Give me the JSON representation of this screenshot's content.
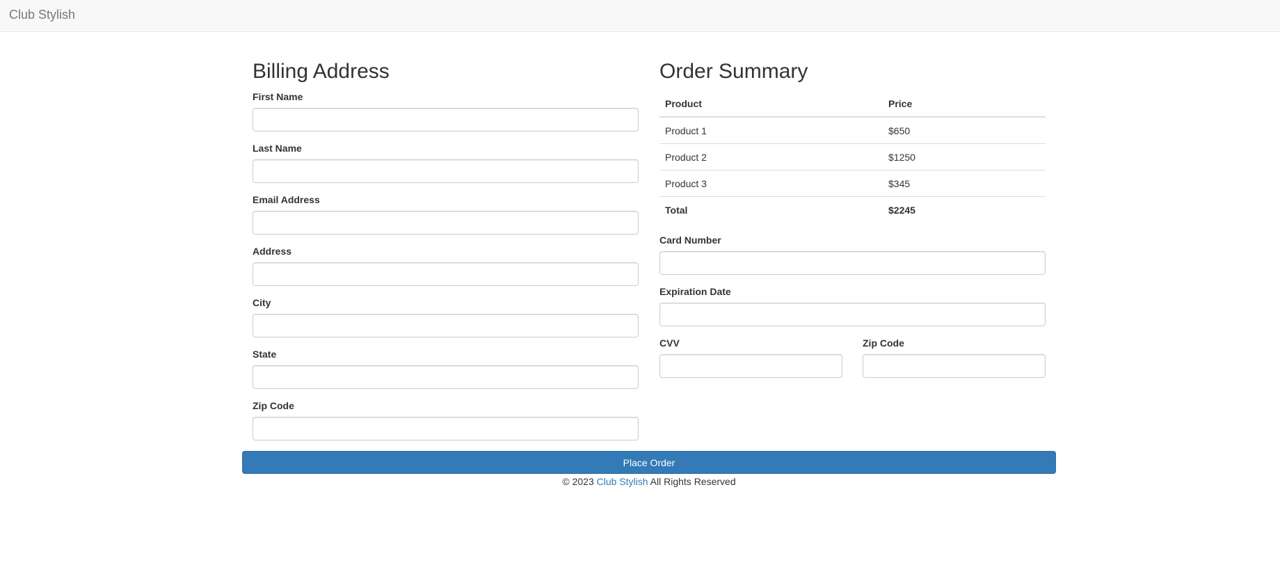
{
  "navbar": {
    "brand": "Club Stylish"
  },
  "billing": {
    "title": "Billing Address",
    "fields": [
      {
        "label": "First Name",
        "value": "",
        "placeholder": ""
      },
      {
        "label": "Last Name",
        "value": "",
        "placeholder": ""
      },
      {
        "label": "Email Address",
        "value": "",
        "placeholder": ""
      },
      {
        "label": "Address",
        "value": "",
        "placeholder": ""
      },
      {
        "label": "City",
        "value": "",
        "placeholder": ""
      },
      {
        "label": "State",
        "value": "",
        "placeholder": ""
      },
      {
        "label": "Zip Code",
        "value": "",
        "placeholder": ""
      }
    ]
  },
  "summary": {
    "title": "Order Summary",
    "columns": [
      "Product",
      "Price"
    ],
    "rows": [
      {
        "product": "Product 1",
        "price": "$650"
      },
      {
        "product": "Product 2",
        "price": "$1250"
      },
      {
        "product": "Product 3",
        "price": "$345"
      }
    ],
    "total": {
      "label": "Total",
      "price": "$2245"
    }
  },
  "payment": {
    "card_number": {
      "label": "Card Number",
      "value": ""
    },
    "expiration": {
      "label": "Expiration Date",
      "value": ""
    },
    "cvv": {
      "label": "CVV",
      "value": ""
    },
    "zip": {
      "label": "Zip Code",
      "value": ""
    }
  },
  "actions": {
    "place_order": "Place Order"
  },
  "footer": {
    "prefix": "© 2023",
    "link": "Club Stylish",
    "suffix": "All Rights Reserved"
  },
  "colors": {
    "primary": "#337ab7",
    "navbar_bg": "#f8f8f8",
    "text": "#333333"
  }
}
